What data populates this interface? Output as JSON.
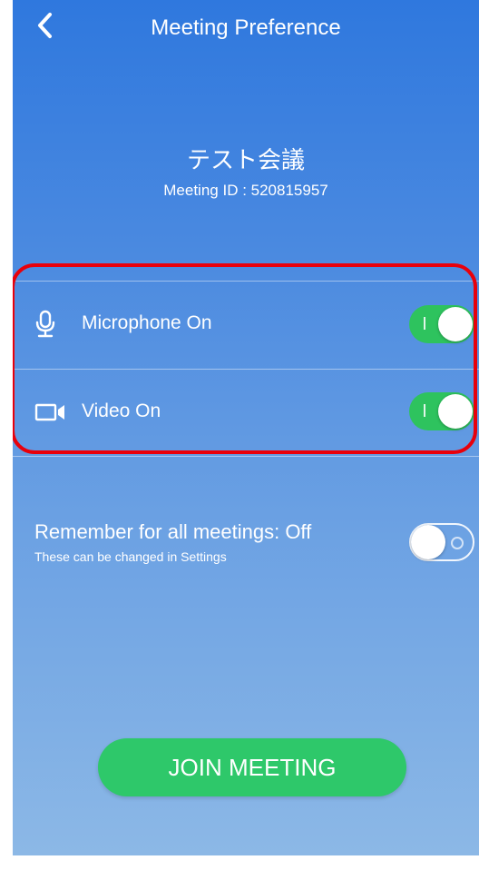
{
  "header": {
    "title": "Meeting Preference",
    "back_icon": "chevron-left-icon"
  },
  "meeting": {
    "name": "テスト会議",
    "id_text": "Meeting ID : 520815957"
  },
  "options": [
    {
      "label": "Microphone On",
      "icon": "microphone-icon",
      "enabled": true
    },
    {
      "label": "Video On",
      "icon": "video-camera-icon",
      "enabled": true
    }
  ],
  "remember": {
    "label": "Remember for all meetings: Off",
    "sublabel": "These can be changed in Settings",
    "enabled": false
  },
  "join_button": {
    "label": "JOIN MEETING"
  },
  "colors": {
    "toggle_on": "#2ec35e",
    "join_button": "#2ec86a",
    "highlight": "#e8000b",
    "background_top": "#2f78de",
    "background_bottom": "#8cb8e6"
  }
}
